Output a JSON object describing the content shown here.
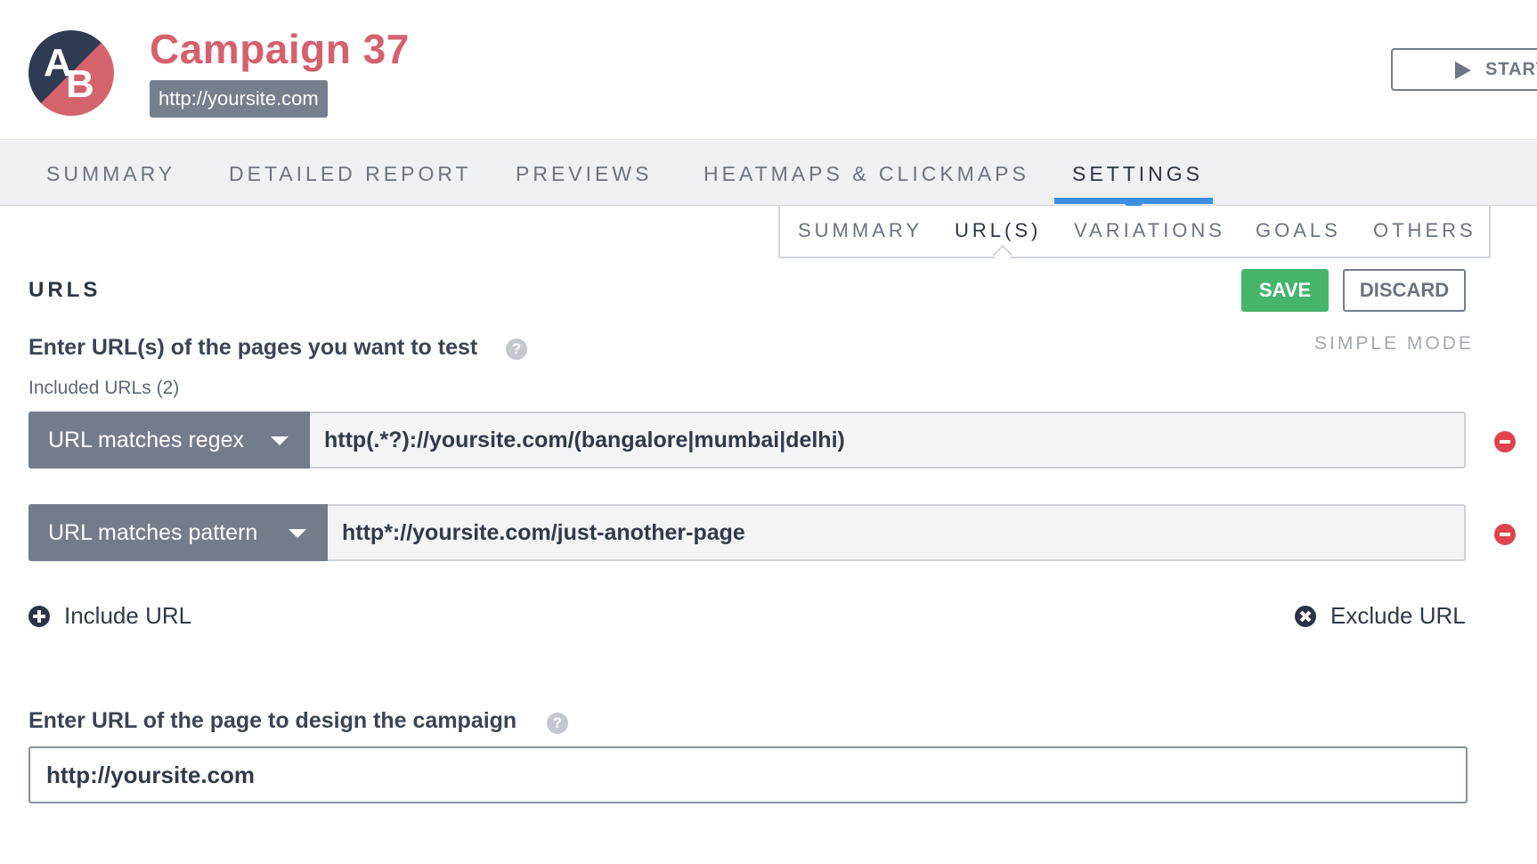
{
  "header": {
    "logo_letter_a": "A",
    "logo_letter_b": "B",
    "campaign_title": "Campaign 37",
    "site_url": "http://yoursite.com",
    "start_label": "START"
  },
  "main_tabs": [
    {
      "label": "SUMMARY"
    },
    {
      "label": "DETAILED REPORT"
    },
    {
      "label": "PREVIEWS"
    },
    {
      "label": "HEATMAPS & CLICKMAPS"
    },
    {
      "label": "SETTINGS",
      "active": true
    }
  ],
  "sub_tabs": [
    {
      "label": "SUMMARY"
    },
    {
      "label": "URL(S)",
      "active": true
    },
    {
      "label": "VARIATIONS"
    },
    {
      "label": "GOALS"
    },
    {
      "label": "OTHERS"
    }
  ],
  "section": {
    "title": "URLS",
    "save_label": "SAVE",
    "discard_label": "DISCARD",
    "simple_mode_label": "SIMPLE MODE",
    "question_label": "Enter URL(s) of the pages you want to test",
    "included_label": "Included URLs (2)"
  },
  "url_rules": [
    {
      "type": "URL matches regex",
      "value": "http(.*?)://yoursite.com/(bangalore|mumbai|delhi)"
    },
    {
      "type": "URL matches pattern",
      "value": "http*://yoursite.com/just-another-page"
    }
  ],
  "actions": {
    "include_label": "Include URL",
    "exclude_label": "Exclude URL"
  },
  "design": {
    "label": "Enter URL of the page to design the campaign",
    "value": "http://yoursite.com"
  },
  "colors": {
    "brand_red": "#d5606e",
    "logo_navy": "#2f3b53",
    "tab_accent": "#3b8ee0",
    "save_green": "#45b56b",
    "remove_red": "#e0434d"
  },
  "icons": {
    "help": "question-circle-icon",
    "remove": "minus-circle-icon",
    "include": "plus-circle-icon",
    "exclude": "x-circle-icon",
    "start": "play-icon",
    "dropdown": "caret-down-icon"
  }
}
